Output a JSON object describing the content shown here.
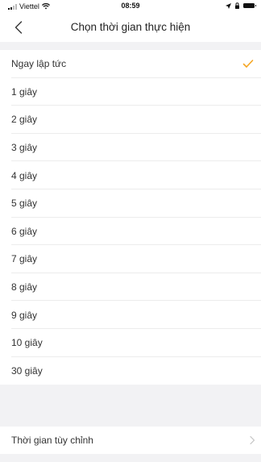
{
  "status_bar": {
    "carrier": "Viettel",
    "time": "08:59",
    "icons": [
      "signal-icon",
      "wifi-icon",
      "location-icon",
      "lock-rotation-icon",
      "battery-icon"
    ]
  },
  "nav": {
    "back_icon": "chevron-left-icon",
    "title": "Chọn thời gian thực hiện"
  },
  "options": [
    {
      "label": "Ngay lập tức",
      "selected": true
    },
    {
      "label": "1 giây",
      "selected": false
    },
    {
      "label": "2 giây",
      "selected": false
    },
    {
      "label": "3 giây",
      "selected": false
    },
    {
      "label": "4 giây",
      "selected": false
    },
    {
      "label": "5 giây",
      "selected": false
    },
    {
      "label": "6 giây",
      "selected": false
    },
    {
      "label": "7 giây",
      "selected": false
    },
    {
      "label": "8 giây",
      "selected": false
    },
    {
      "label": "9 giây",
      "selected": false
    },
    {
      "label": "10 giây",
      "selected": false
    },
    {
      "label": "30 giây",
      "selected": false
    }
  ],
  "custom": {
    "label": "Thời gian tùy chỉnh",
    "icon": "chevron-right-icon"
  },
  "colors": {
    "accent": "#f5a623",
    "background": "#f2f2f4",
    "row": "#ffffff",
    "divider": "#ececec"
  }
}
